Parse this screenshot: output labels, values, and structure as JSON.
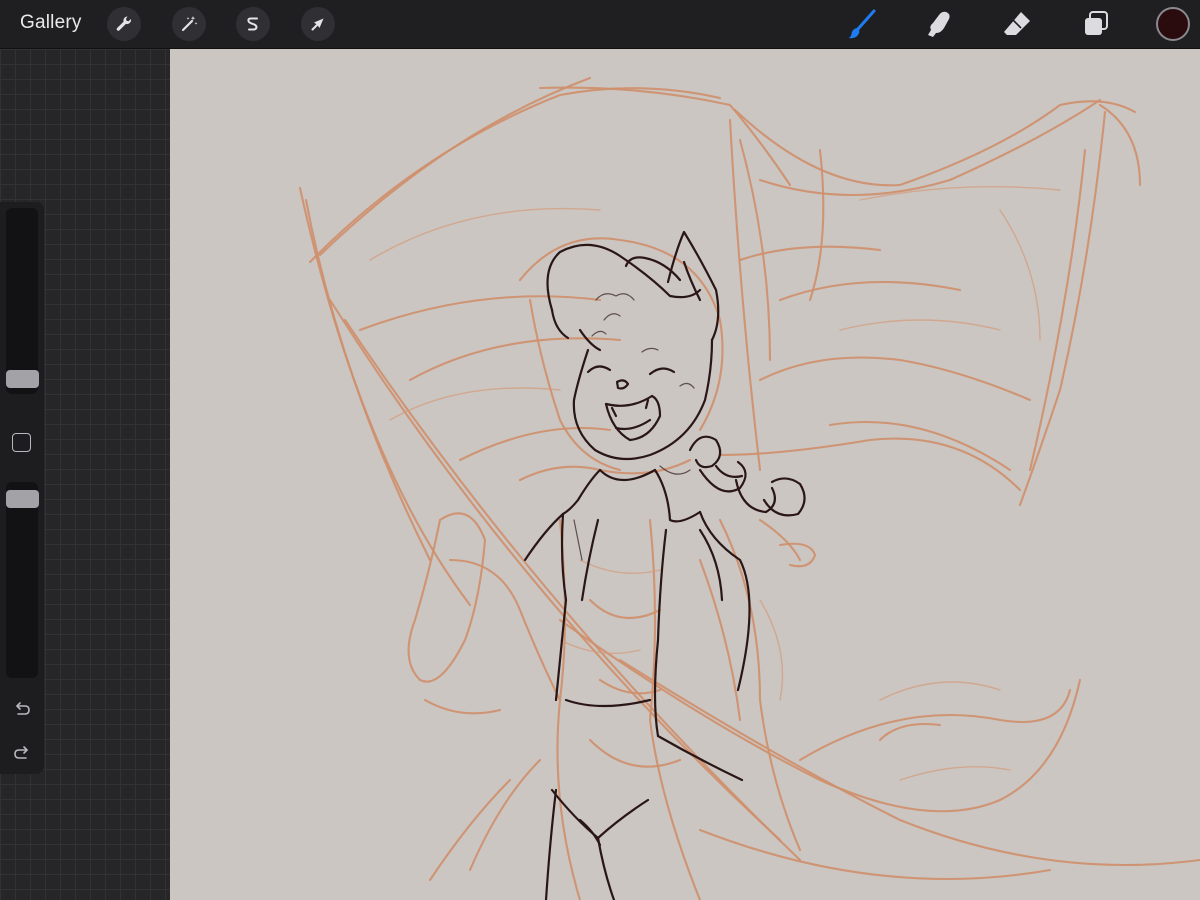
{
  "topbar": {
    "gallery_label": "Gallery",
    "left_tools": [
      {
        "name": "actions",
        "icon": "wrench-icon"
      },
      {
        "name": "adjustments",
        "icon": "magic-wand-icon"
      },
      {
        "name": "selection",
        "icon": "selection-s-icon"
      },
      {
        "name": "transform",
        "icon": "arrow-cursor-icon"
      }
    ],
    "right_tools": [
      {
        "name": "brush",
        "icon": "brush-icon",
        "active": true
      },
      {
        "name": "smudge",
        "icon": "smudge-finger-icon",
        "active": false
      },
      {
        "name": "eraser",
        "icon": "eraser-icon",
        "active": false
      },
      {
        "name": "layers",
        "icon": "layers-icon",
        "active": false
      }
    ],
    "current_color": "#2a0c0e",
    "active_tool_color": "#1e7cf2"
  },
  "sidebar": {
    "brush_size_level": 0.1,
    "opacity_level": 0.95,
    "modify_button_icon": "square-icon",
    "undo_icon": "undo-arrow-icon",
    "redo_icon": "redo-arrow-icon"
  },
  "canvas": {
    "background": "#cbc6c2",
    "sketch_color": "#cf8f6c",
    "ink_color": "#2a1616"
  }
}
